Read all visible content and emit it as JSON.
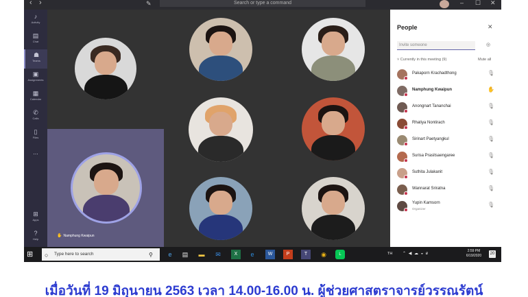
{
  "titlebar": {
    "search_placeholder": "Search or type a command",
    "back": "‹",
    "forward": "›",
    "minimize": "–",
    "maximize": "☐",
    "close": "✕"
  },
  "rail": {
    "items": [
      {
        "label": "Activity",
        "icon": "bell-icon"
      },
      {
        "label": "Chat",
        "icon": "chat-icon"
      },
      {
        "label": "Teams",
        "icon": "teams-icon"
      },
      {
        "label": "Assignments",
        "icon": "assignments-icon"
      },
      {
        "label": "Calendar",
        "icon": "calendar-icon"
      },
      {
        "label": "Calls",
        "icon": "phone-icon"
      },
      {
        "label": "Files",
        "icon": "files-icon"
      },
      {
        "label": "...",
        "icon": "more-icon"
      },
      {
        "label": "Apps",
        "icon": "apps-icon"
      },
      {
        "label": "Help",
        "icon": "help-icon"
      }
    ]
  },
  "video": {
    "speaker_name": "Namphung Kwaipun"
  },
  "people_panel": {
    "title": "People",
    "invite_placeholder": "Invite someone",
    "current_label": "Currently in this meeting (9)",
    "mute_all": "Mute all",
    "participants": [
      {
        "name": "Pakaporn Krachadthong",
        "bold": false,
        "status": "muted"
      },
      {
        "name": "Namphung Kwaipun",
        "bold": true,
        "status": "hand-raised"
      },
      {
        "name": "Anongnart Tananchai",
        "bold": false,
        "status": "muted"
      },
      {
        "name": "Rhatiya Nontirach",
        "bold": false,
        "status": "muted"
      },
      {
        "name": "Sirinart Paetyangkul",
        "bold": false,
        "status": "muted"
      },
      {
        "name": "Surisa Prasitsaengaree",
        "bold": false,
        "status": "muted"
      },
      {
        "name": "Suthita Julakanit",
        "bold": false,
        "status": "muted"
      },
      {
        "name": "Wannarat Sriratna",
        "bold": false,
        "status": "muted"
      },
      {
        "name": "Yupin Kamsorn",
        "bold": false,
        "status": "muted",
        "role": "Organizer"
      }
    ]
  },
  "taskbar": {
    "search_placeholder": "Type here to search",
    "lang": "TH",
    "time": "2:59 PM",
    "date": "6/19/2020",
    "notif_count": "20"
  },
  "caption": "เมื่อวันที่ 19 มิถุนายน 2563 เวลา 14.00-16.00 น. ผู้ช่วยศาสตราจารย์วรรณรัตน์"
}
